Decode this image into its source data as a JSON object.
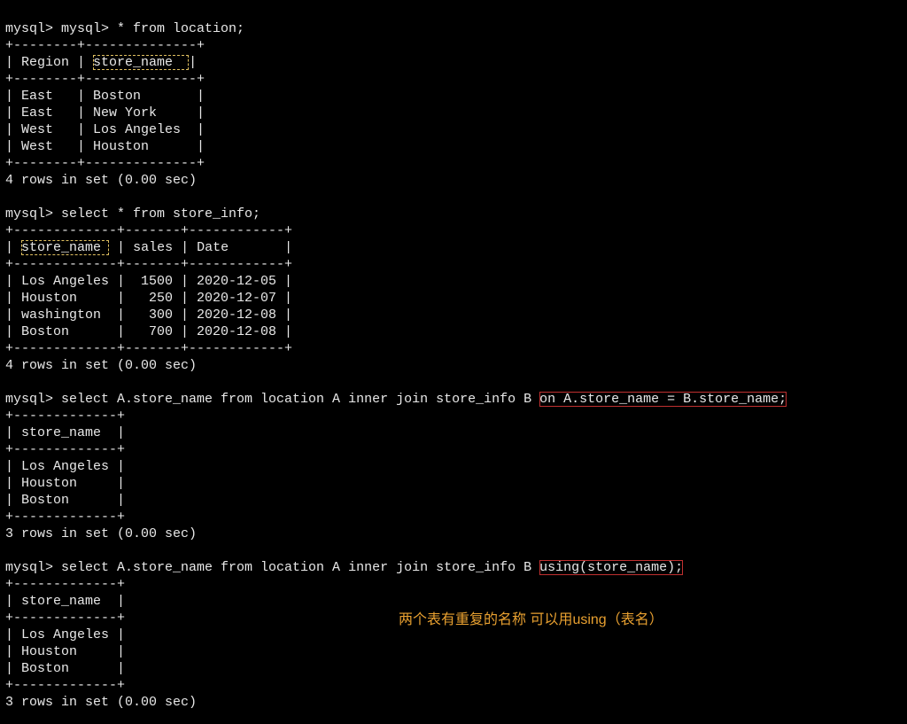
{
  "q1": {
    "prompt": "mysql> mysql> * from location;",
    "sep": "+--------+--------------+",
    "hdr_pre": "| ",
    "h_region": "Region",
    "hdr_mid": " | ",
    "h_store": "store_name  ",
    "hdr_post": "|",
    "r1": "| East   | Boston       |",
    "r2": "| East   | New York     |",
    "r3": "| West   | Los Angeles  |",
    "r4": "| West   | Houston      |",
    "status": "4 rows in set (0.00 sec)"
  },
  "q2": {
    "prompt": "mysql> select * from store_info;",
    "sep": "+-------------+-------+------------+",
    "hdr_pre": "| ",
    "h_store": "store_name ",
    "hdr_mid1": " | ",
    "h_sales": "sales",
    "hdr_mid2": " | ",
    "h_date": "Date      ",
    "hdr_post": " |",
    "r1": "| Los Angeles |  1500 | 2020-12-05 |",
    "r2": "| Houston     |   250 | 2020-12-07 |",
    "r3": "| washington  |   300 | 2020-12-08 |",
    "r4": "| Boston      |   700 | 2020-12-08 |",
    "status": "4 rows in set (0.00 sec)"
  },
  "q3": {
    "prompt_pre": "mysql> select A.store_name from location A inner join store_info B ",
    "prompt_hl": "on A.store_name = B.store_name;",
    "sep": "+-------------+",
    "hdr": "| store_name  |",
    "r1": "| Los Angeles |",
    "r2": "| Houston     |",
    "r3": "| Boston      |",
    "status": "3 rows in set (0.00 sec)"
  },
  "q4": {
    "prompt_pre": "mysql> select A.store_name from location A inner join store_info B ",
    "prompt_hl": "using(store_name);",
    "sep": "+-------------+",
    "hdr": "| store_name  |",
    "r1": "| Los Angeles |",
    "r2": "| Houston     |",
    "r3": "| Boston      |",
    "status": "3 rows in set (0.00 sec)"
  },
  "annotation": "两个表有重复的名称 可以用using（表名）"
}
